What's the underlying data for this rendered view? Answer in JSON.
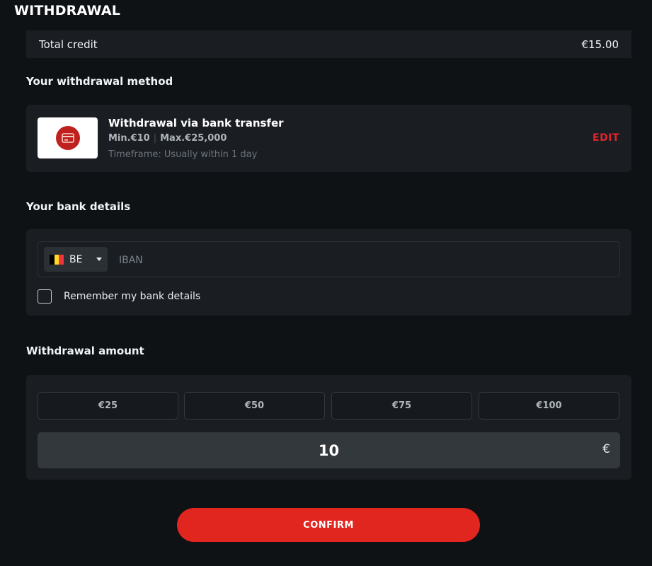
{
  "page": {
    "title": "WITHDRAWAL"
  },
  "credit": {
    "label": "Total credit",
    "value": "€15.00"
  },
  "method": {
    "section_title": "Your withdrawal method",
    "name": "Withdrawal via bank transfer",
    "min": "Min.€10",
    "max": "Max.€25,000",
    "timeframe": "Timeframe: Usually within 1 day",
    "edit_label": "EDIT",
    "icon": "credit-card-icon"
  },
  "bank": {
    "section_title": "Your bank details",
    "country_code": "BE",
    "flag_colors": [
      "#000000",
      "#fdda24",
      "#ef3340"
    ],
    "iban_placeholder": "IBAN",
    "iban_value": "",
    "remember_label": "Remember my bank details",
    "remember_checked": false
  },
  "amount": {
    "section_title": "Withdrawal amount",
    "presets": [
      "€25",
      "€50",
      "€75",
      "€100"
    ],
    "value": "10",
    "currency": "€"
  },
  "confirm_label": "CONFIRM",
  "colors": {
    "accent": "#e1251f",
    "background": "#0f1215",
    "card": "#1a1e23"
  }
}
